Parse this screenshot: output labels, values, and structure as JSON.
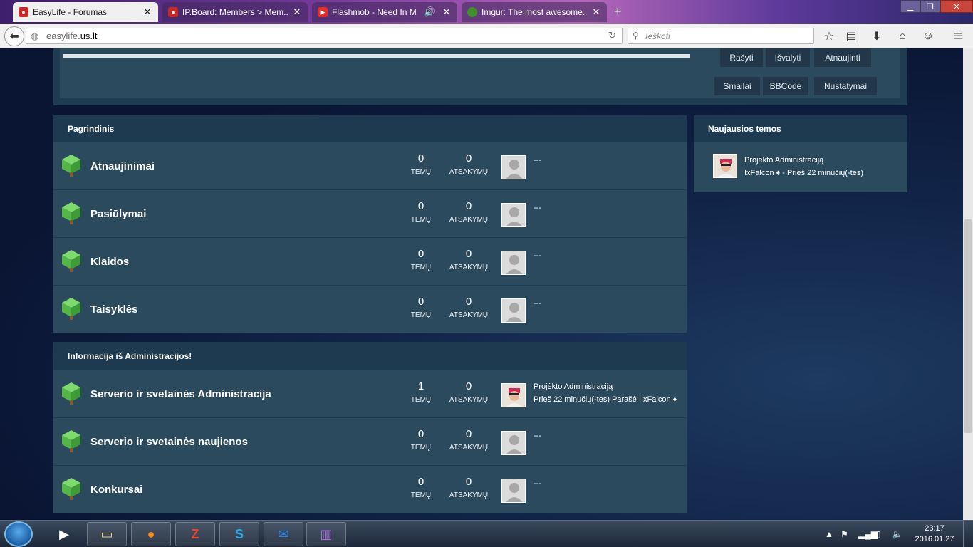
{
  "browser": {
    "tabs": [
      {
        "title": "EasyLife - Forumas",
        "active": true
      },
      {
        "title": "IP.Board: Members > Mem..."
      },
      {
        "title": "Flashmob - Need In M..."
      },
      {
        "title": "Imgur: The most awesome..."
      }
    ],
    "new_tab": "+",
    "url_prefix": "easylife.",
    "url_domain": "us.lt",
    "search_placeholder": "Ieškoti"
  },
  "editor_buttons": {
    "row1": [
      "Rašyti",
      "Išvalyti",
      "Atnaujinti"
    ],
    "row2": [
      "Smailai",
      "BBCode",
      "Nustatymai"
    ]
  },
  "categories": [
    {
      "title": "Pagrindinis",
      "forums": [
        {
          "name": "Atnaujinimai",
          "topics": "0",
          "replies": "0",
          "last": "---"
        },
        {
          "name": "Pasiūlymai",
          "topics": "0",
          "replies": "0",
          "last": "---"
        },
        {
          "name": "Klaidos",
          "topics": "0",
          "replies": "0",
          "last": "---"
        },
        {
          "name": "Taisyklės",
          "topics": "0",
          "replies": "0",
          "last": "---"
        }
      ]
    },
    {
      "title": "Informacija iš Administracijos!",
      "forums": [
        {
          "name": "Serverio ir svetainės Administracija",
          "topics": "1",
          "replies": "0",
          "last_title": "Projėkto Administraciją",
          "last_meta": "Prieš 22 minučių(-tes) Parašė: IxFalcon ♦"
        },
        {
          "name": "Serverio ir svetainės naujienos",
          "topics": "0",
          "replies": "0",
          "last": "---"
        },
        {
          "name": "Konkursai",
          "topics": "0",
          "replies": "0",
          "last": "---"
        }
      ]
    }
  ],
  "labels": {
    "topics": "TEMŲ",
    "replies": "ATSAKYMŲ"
  },
  "sidebar": {
    "title": "Naujausios temos",
    "items": [
      {
        "title": "Projėkto Administraciją",
        "meta": "IxFalcon ♦ - Prieš 22 minučių(-tes)"
      }
    ]
  },
  "taskbar": {
    "time": "23:17",
    "date": "2016.01.27"
  },
  "colors": {
    "accent": "#2c4a5e",
    "header": "#1e3a50",
    "cube": "#55b548"
  }
}
